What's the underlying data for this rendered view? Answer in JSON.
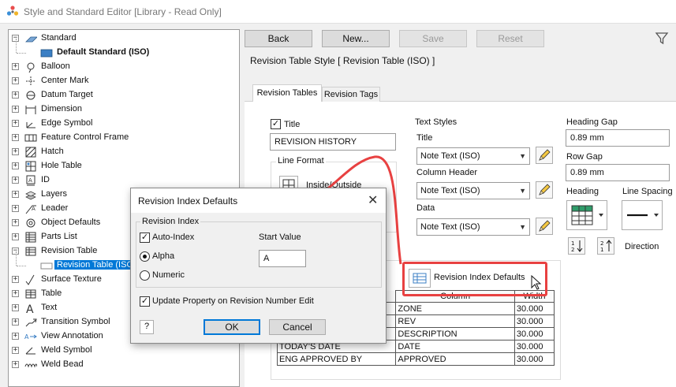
{
  "window": {
    "title": "Style and Standard Editor [Library - Read Only]"
  },
  "toolbar": {
    "back": "Back",
    "new": "New...",
    "save": "Save",
    "reset": "Reset"
  },
  "tree": {
    "items": [
      {
        "label": "Standard",
        "icon": "standard-icon",
        "level": 0,
        "expander": "-"
      },
      {
        "label": "Default Standard (ISO)",
        "icon": "standard-sheet-icon",
        "level": 1,
        "bold": true
      },
      {
        "label": "Balloon",
        "icon": "balloon-icon",
        "level": 0,
        "expander": "+"
      },
      {
        "label": "Center Mark",
        "icon": "center-mark-icon",
        "level": 0,
        "expander": "+"
      },
      {
        "label": "Datum Target",
        "icon": "datum-target-icon",
        "level": 0,
        "expander": "+"
      },
      {
        "label": "Dimension",
        "icon": "dimension-icon",
        "level": 0,
        "expander": "+"
      },
      {
        "label": "Edge Symbol",
        "icon": "edge-symbol-icon",
        "level": 0,
        "expander": "+"
      },
      {
        "label": "Feature Control Frame",
        "icon": "feature-control-frame-icon",
        "level": 0,
        "expander": "+"
      },
      {
        "label": "Hatch",
        "icon": "hatch-icon",
        "level": 0,
        "expander": "+"
      },
      {
        "label": "Hole Table",
        "icon": "hole-table-icon",
        "level": 0,
        "expander": "+"
      },
      {
        "label": "ID",
        "icon": "id-icon",
        "level": 0,
        "expander": "+"
      },
      {
        "label": "Layers",
        "icon": "layers-icon",
        "level": 0,
        "expander": "+"
      },
      {
        "label": "Leader",
        "icon": "leader-icon",
        "level": 0,
        "expander": "+"
      },
      {
        "label": "Object Defaults",
        "icon": "object-defaults-icon",
        "level": 0,
        "expander": "+"
      },
      {
        "label": "Parts List",
        "icon": "parts-list-icon",
        "level": 0,
        "expander": "+"
      },
      {
        "label": "Revision Table",
        "icon": "revision-table-icon",
        "level": 0,
        "expander": "-"
      },
      {
        "label": "Revision Table (ISO)",
        "icon": "revision-table-item-icon",
        "level": 1,
        "selected": true
      },
      {
        "label": "Surface Texture",
        "icon": "surface-texture-icon",
        "level": 0,
        "expander": "+"
      },
      {
        "label": "Table",
        "icon": "table-icon",
        "level": 0,
        "expander": "+"
      },
      {
        "label": "Text",
        "icon": "text-icon",
        "level": 0,
        "expander": "+"
      },
      {
        "label": "Transition Symbol",
        "icon": "transition-symbol-icon",
        "level": 0,
        "expander": "+"
      },
      {
        "label": "View Annotation",
        "icon": "view-annotation-icon",
        "level": 0,
        "expander": "+"
      },
      {
        "label": "Weld Symbol",
        "icon": "weld-symbol-icon",
        "level": 0,
        "expander": "+"
      },
      {
        "label": "Weld Bead",
        "icon": "weld-bead-icon",
        "level": 0,
        "expander": "+"
      }
    ]
  },
  "style_header": "Revision Table Style [ Revision Table (ISO) ]",
  "tabs": [
    {
      "label": "Revision Tables",
      "active": true
    },
    {
      "label": "Revision Tags",
      "active": false
    }
  ],
  "title_section": {
    "checkbox_label": "Title",
    "checked": true,
    "value": "REVISION HISTORY"
  },
  "line_format": {
    "label": "Line Format",
    "option": "Inside/Outside"
  },
  "text_styles": {
    "label": "Text Styles",
    "title_label": "Title",
    "title_value": "Note Text (ISO)",
    "column_header_label": "Column Header",
    "column_header_value": "Note Text (ISO)",
    "data_label": "Data",
    "data_value": "Note Text (ISO)"
  },
  "gaps": {
    "heading_gap_label": "Heading Gap",
    "heading_gap_value": "0.89 mm",
    "row_gap_label": "Row Gap",
    "row_gap_value": "0.89 mm"
  },
  "heading": {
    "label": "Heading"
  },
  "line_spacing": {
    "label": "Line Spacing"
  },
  "direction": {
    "label": "Direction"
  },
  "rev_index_button": {
    "label": "Revision Index Defaults"
  },
  "columns_table": {
    "headers": [
      "Column",
      "Width"
    ],
    "rows": [
      [
        "",
        "ZONE",
        "30.000"
      ],
      [
        "",
        "REV",
        "30.000"
      ],
      [
        "",
        "DESCRIPTION",
        "30.000"
      ],
      [
        "TODAY'S DATE",
        "DATE",
        "30.000"
      ],
      [
        "ENG APPROVED BY",
        "APPROVED",
        "30.000"
      ]
    ]
  },
  "dialog": {
    "title": "Revision Index Defaults",
    "group_label": "Revision Index",
    "auto_index_label": "Auto-Index",
    "auto_index_checked": true,
    "alpha_label": "Alpha",
    "numeric_label": "Numeric",
    "selected": "Alpha",
    "start_value_label": "Start Value",
    "start_value": "A",
    "update_label": "Update Property on Revision Number Edit",
    "update_checked": true,
    "ok": "OK",
    "cancel": "Cancel",
    "help": "?"
  },
  "colors": {
    "highlight": "#e84141",
    "selection": "#0078d7",
    "accent_icon": "#3b7fc4"
  }
}
